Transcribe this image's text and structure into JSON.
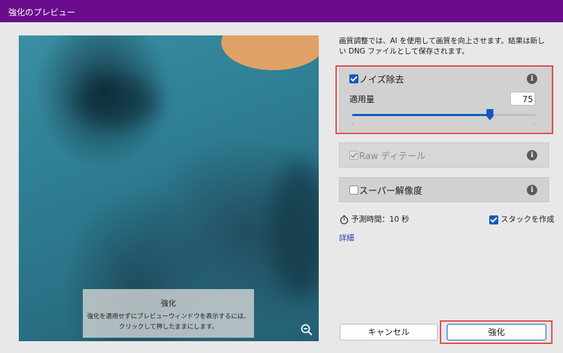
{
  "window": {
    "title": "強化のプレビュー",
    "title_bar_color": "#6b0c8c"
  },
  "preview": {
    "overlay_title": "強化",
    "overlay_line1": "強化を適用せずにプレビューウィンドウを表示するには、",
    "overlay_line2": "クリックして押したままにします。",
    "zoom_icon": "zoom-out-icon"
  },
  "panel": {
    "description": "画質調整では、AI を使用して画質を向上させます。結果は新しい DNG ファイルとして保存されます。",
    "denoise": {
      "label": "ノイズ除去",
      "checked": true,
      "amount_label": "適用量",
      "amount_value": "75",
      "slider_fraction": 0.75
    },
    "raw_detail": {
      "label": "Raw ディテール",
      "checked": true,
      "disabled": true
    },
    "super_resolution": {
      "label": "スーパー解像度",
      "checked": false
    },
    "eta_label": "予測時間：10 秒",
    "stack_label": "スタックを作成",
    "stack_checked": true,
    "details_link": "詳細"
  },
  "buttons": {
    "cancel": "キャンセル",
    "enhance": "強化"
  },
  "colors": {
    "accent": "#0f5bbd",
    "highlight": "#e04b4b"
  }
}
